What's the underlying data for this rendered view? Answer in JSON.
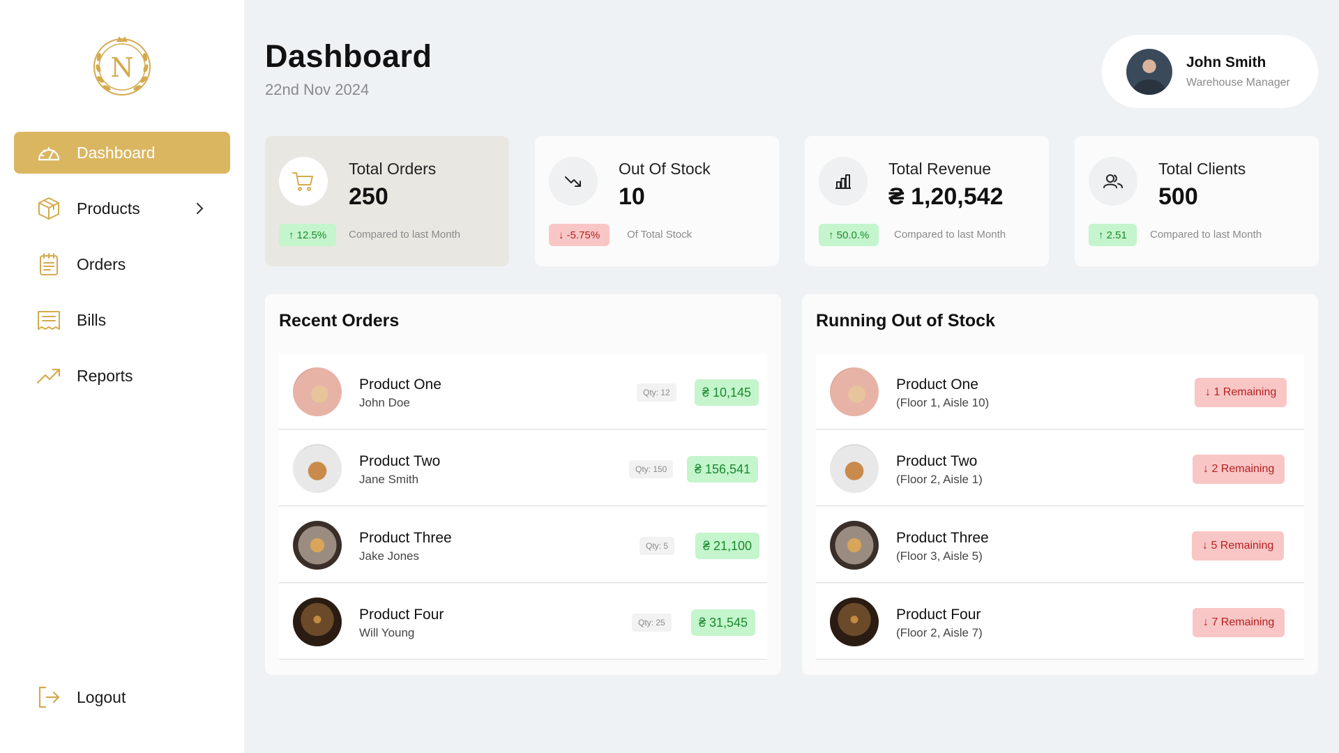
{
  "sidebar": {
    "logo_letters": "N",
    "items": [
      {
        "label": "Dashboard",
        "icon": "gauge-icon",
        "active": true
      },
      {
        "label": "Products",
        "icon": "box-icon",
        "has_submenu": true
      },
      {
        "label": "Orders",
        "icon": "clipboard-icon"
      },
      {
        "label": "Bills",
        "icon": "bill-icon"
      },
      {
        "label": "Reports",
        "icon": "trend-up-icon"
      }
    ],
    "logout_label": "Logout"
  },
  "header": {
    "title": "Dashboard",
    "date": "22nd Nov 2024"
  },
  "profile": {
    "name": "John Smith",
    "role": "Warehouse Manager"
  },
  "stats": [
    {
      "title": "Total Orders",
      "value": "250",
      "badge": "↑ 12.5%",
      "trend": "up",
      "note": "Compared to last Month",
      "icon": "cart-icon"
    },
    {
      "title": "Out Of Stock",
      "value": "10",
      "badge": "↓ -5.75%",
      "trend": "down",
      "note": "Of Total Stock",
      "icon": "trend-down-icon"
    },
    {
      "title": "Total Revenue",
      "value": "₴ 1,20,542",
      "badge": "↑ 50.0.%",
      "trend": "up",
      "note": "Compared to last Month",
      "icon": "bar-chart-icon"
    },
    {
      "title": "Total Clients",
      "value": "500",
      "badge": "↑ 2.51",
      "trend": "up",
      "note": "Compared to last Month",
      "icon": "users-icon"
    }
  ],
  "recent_orders": {
    "title": "Recent Orders",
    "rows": [
      {
        "name": "Product One",
        "customer": "John Doe",
        "qty": "Qty: 12",
        "price": "₴ 10,145"
      },
      {
        "name": "Product Two",
        "customer": "Jane Smith",
        "qty": "Qty: 150",
        "price": "₴ 156,541"
      },
      {
        "name": "Product Three",
        "customer": "Jake Jones",
        "qty": "Qty: 5",
        "price": "₴ 21,100"
      },
      {
        "name": "Product Four",
        "customer": "Will Young",
        "qty": "Qty: 25",
        "price": "₴ 31,545"
      }
    ]
  },
  "running_out": {
    "title": "Running Out of Stock",
    "rows": [
      {
        "name": "Product One",
        "location": "(Floor 1, Aisle 10)",
        "remaining": "↓ 1 Remaining"
      },
      {
        "name": "Product Two",
        "location": "(Floor 2, Aisle 1)",
        "remaining": "↓ 2 Remaining"
      },
      {
        "name": "Product Three",
        "location": "(Floor 3, Aisle 5)",
        "remaining": "↓ 5 Remaining"
      },
      {
        "name": "Product Four",
        "location": "(Floor 2, Aisle 7)",
        "remaining": "↓ 7 Remaining"
      }
    ]
  },
  "colors": {
    "accent": "#dbb660",
    "background": "#eff2f4",
    "badge_up_bg": "#c4f5cc",
    "badge_up_text": "#1b8a2f",
    "badge_down_bg": "#f9c6c6",
    "badge_down_text": "#b51f1f"
  }
}
